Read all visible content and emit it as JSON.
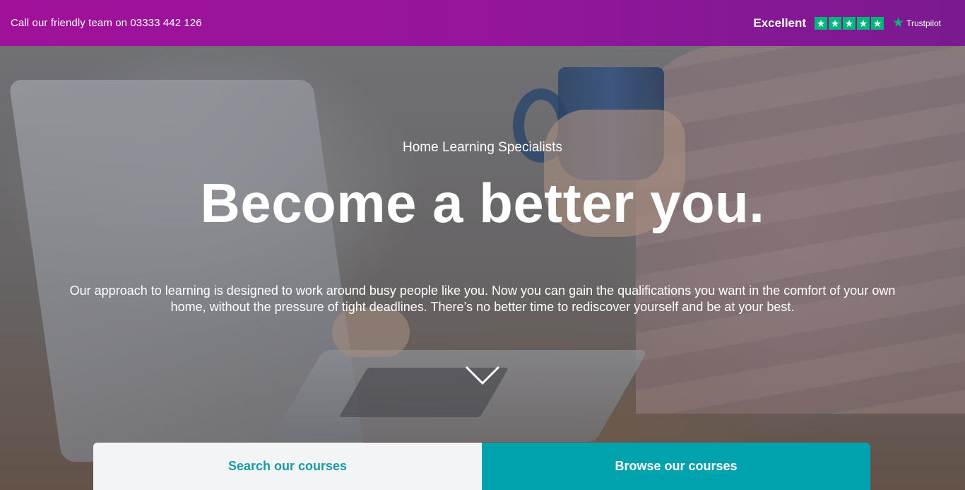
{
  "topbar": {
    "phone_text": "Call our friendly team on 03333 442 126",
    "trustpilot": {
      "rating_text": "Excellent",
      "star_count": 5,
      "brand": "Trustpilot",
      "star_color": "#00b67a"
    }
  },
  "hero": {
    "eyebrow": "Home Learning Specialists",
    "headline": "Become a better you.",
    "subcopy": "Our approach to learning is designed to work around busy people like you. Now you can gain the qualifications you want in the comfort of your own home, without the pressure of tight deadlines. There’s no better time to rediscover yourself and be at your best.",
    "scroll_icon": "chevron-down-icon"
  },
  "cta": {
    "search_label": "Search our courses",
    "browse_label": "Browse our courses",
    "accent_color": "#00a2ad"
  },
  "colors": {
    "topbar_start": "#a0119a",
    "topbar_end": "#7a1a8f"
  }
}
